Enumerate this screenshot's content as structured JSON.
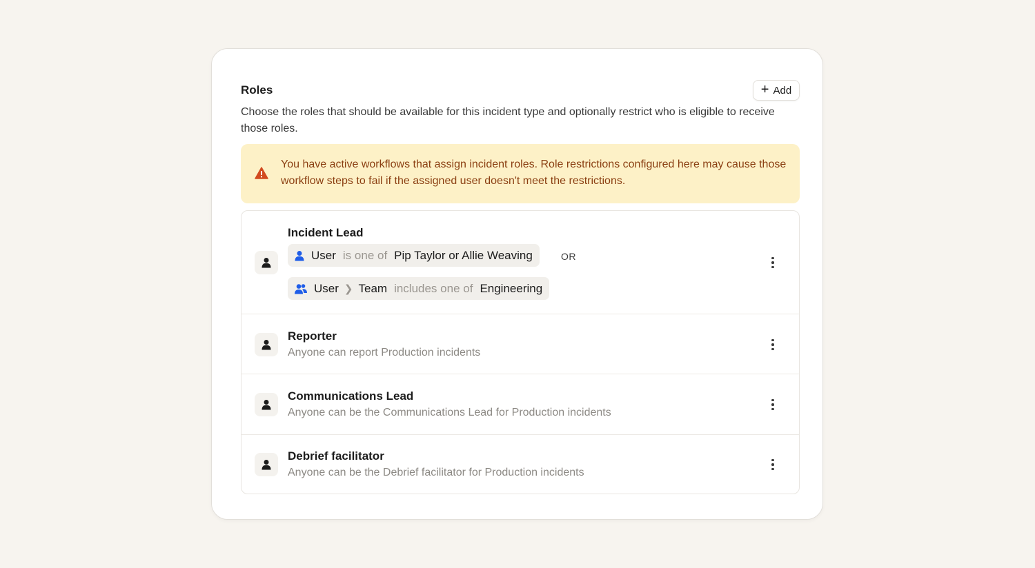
{
  "section": {
    "title": "Roles",
    "add_label": "Add",
    "description": "Choose the roles that should be available for this incident type and optionally restrict who is eligible to receive those roles."
  },
  "alert": {
    "text": "You have active workflows that assign incident roles. Role restrictions configured here may cause those workflow steps to fail if the assigned user doesn't meet the restrictions.",
    "color": "#8b3f12",
    "background": "#fdf1c7",
    "icon": "warning-triangle-icon"
  },
  "roles": [
    {
      "title": "Incident Lead",
      "conditions": [
        {
          "subject": "User",
          "operator": "is one of",
          "value": "Pip Taylor or Allie Weaving",
          "icon": "user-icon"
        },
        {
          "subject": "User",
          "sub_field": "Team",
          "operator": "includes one of",
          "value": "Engineering",
          "icon": "team-icon"
        }
      ],
      "joiner": "OR"
    },
    {
      "title": "Reporter",
      "subtitle": "Anyone can report Production incidents"
    },
    {
      "title": "Communications Lead",
      "subtitle": "Anyone can be the Communications Lead for Production incidents"
    },
    {
      "title": "Debrief facilitator",
      "subtitle": "Anyone can be the Debrief facilitator for Production incidents"
    }
  ],
  "colors": {
    "accent_blue": "#1f5de8",
    "background": "#f7f4ef"
  }
}
